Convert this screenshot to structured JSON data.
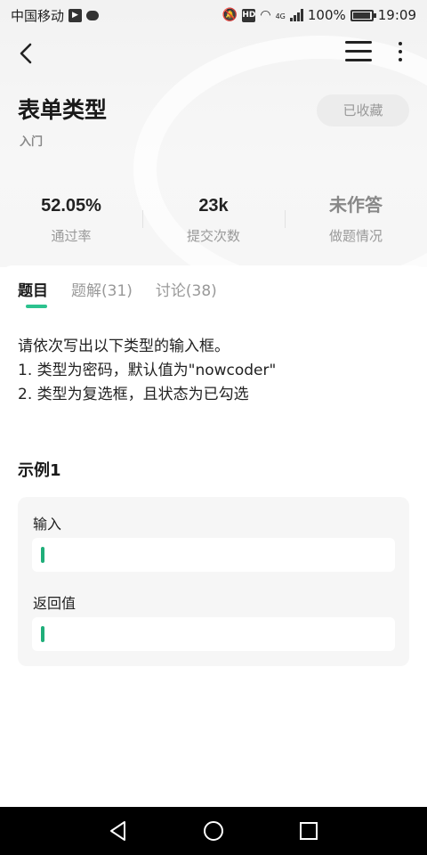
{
  "status_bar": {
    "carrier": "中国移动",
    "network": "4G",
    "battery": "100%",
    "time": "19:09",
    "hd_label": "HD"
  },
  "nav": {
    "back_icon": "chevron-left-icon",
    "menu_icon": "hamburger-icon",
    "more_icon": "more-vertical-icon"
  },
  "header": {
    "title": "表单类型",
    "favorite_label": "已收藏",
    "difficulty": "入门"
  },
  "stats": [
    {
      "value": "52.05%",
      "label": "通过率"
    },
    {
      "value": "23k",
      "label": "提交次数"
    },
    {
      "value": "未作答",
      "label": "做题情况"
    }
  ],
  "tabs": [
    {
      "label": "题目",
      "active": true
    },
    {
      "label": "题解(31)",
      "active": false
    },
    {
      "label": "讨论(38)",
      "active": false
    }
  ],
  "description": [
    "请依次写出以下类型的输入框。",
    "1. 类型为密码，默认值为\"nowcoder\"",
    "2. 类型为复选框，且状态为已勾选"
  ],
  "example": {
    "title": "示例1",
    "input_label": "输入",
    "input_value": "",
    "output_label": "返回值",
    "output_value": ""
  },
  "colors": {
    "accent": "#2cc28e",
    "caret": "#1fae79"
  }
}
